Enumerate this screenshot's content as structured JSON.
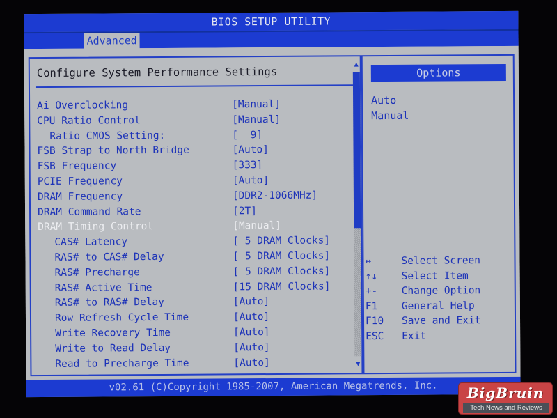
{
  "window": {
    "title": "BIOS SETUP UTILITY",
    "active_tab": "Advanced"
  },
  "main": {
    "section_title": "Configure System Performance Settings",
    "settings": [
      {
        "label": "Ai Overclocking",
        "value": "[Manual]",
        "indent": 0,
        "state": "normal"
      },
      {
        "label": "CPU Ratio Control",
        "value": "[Manual]",
        "indent": 0,
        "state": "normal"
      },
      {
        "label": "Ratio CMOS Setting:",
        "value": "[  9]",
        "indent": 1,
        "state": "normal"
      },
      {
        "label": "FSB Strap to North Bridge",
        "value": "[Auto]",
        "indent": 0,
        "state": "normal"
      },
      {
        "label": "FSB Frequency",
        "value": "[333]",
        "indent": 0,
        "state": "normal"
      },
      {
        "label": "PCIE Frequency",
        "value": "[Auto]",
        "indent": 0,
        "state": "normal"
      },
      {
        "label": "DRAM Frequency",
        "value": "[DDR2-1066MHz]",
        "indent": 0,
        "state": "normal"
      },
      {
        "label": "DRAM Command Rate",
        "value": "[2T]",
        "indent": 0,
        "state": "normal"
      },
      {
        "label": "DRAM Timing Control",
        "value": "[Manual]",
        "indent": 0,
        "state": "selected"
      },
      {
        "label": "CAS# Latency",
        "value": "[ 5 DRAM Clocks]",
        "indent": 2,
        "state": "normal"
      },
      {
        "label": "RAS# to CAS# Delay",
        "value": "[ 5 DRAM Clocks]",
        "indent": 2,
        "state": "normal"
      },
      {
        "label": "RAS# Precharge",
        "value": "[ 5 DRAM Clocks]",
        "indent": 2,
        "state": "normal"
      },
      {
        "label": "RAS# Active Time",
        "value": "[15 DRAM Clocks]",
        "indent": 2,
        "state": "normal"
      },
      {
        "label": "RAS# to RAS# Delay",
        "value": "[Auto]",
        "indent": 2,
        "state": "normal"
      },
      {
        "label": "Row Refresh Cycle Time",
        "value": "[Auto]",
        "indent": 2,
        "state": "normal"
      },
      {
        "label": "Write Recovery Time",
        "value": "[Auto]",
        "indent": 2,
        "state": "normal"
      },
      {
        "label": "Write to Read Delay",
        "value": "[Auto]",
        "indent": 2,
        "state": "normal"
      },
      {
        "label": "Read to Precharge Time",
        "value": "[Auto]",
        "indent": 2,
        "state": "normal"
      }
    ],
    "scrollbar": {
      "up_icon": "▲",
      "down_icon": "▼",
      "thumb_fraction": 0.55,
      "position_fraction": 0.0
    }
  },
  "side": {
    "options_header": "Options",
    "options": [
      "Auto",
      "Manual"
    ],
    "help": [
      {
        "key": "↔",
        "desc": "Select Screen"
      },
      {
        "key": "↑↓",
        "desc": "Select Item"
      },
      {
        "key": "+-",
        "desc": "Change Option"
      },
      {
        "key": "F1",
        "desc": "General Help"
      },
      {
        "key": "F10",
        "desc": "Save and Exit"
      },
      {
        "key": "ESC",
        "desc": "Exit"
      }
    ]
  },
  "footer": {
    "text": "v02.61 (C)Copyright 1985-2007, American Megatrends, Inc."
  },
  "watermark": {
    "title": "BigBruin",
    "subtitle": "Tech News and Reviews"
  },
  "colors": {
    "bios_blue": "#1c3bd1",
    "panel_gray": "#b9bcc0",
    "text_blue": "#1d33b8",
    "selected_text": "#ecedf0"
  }
}
